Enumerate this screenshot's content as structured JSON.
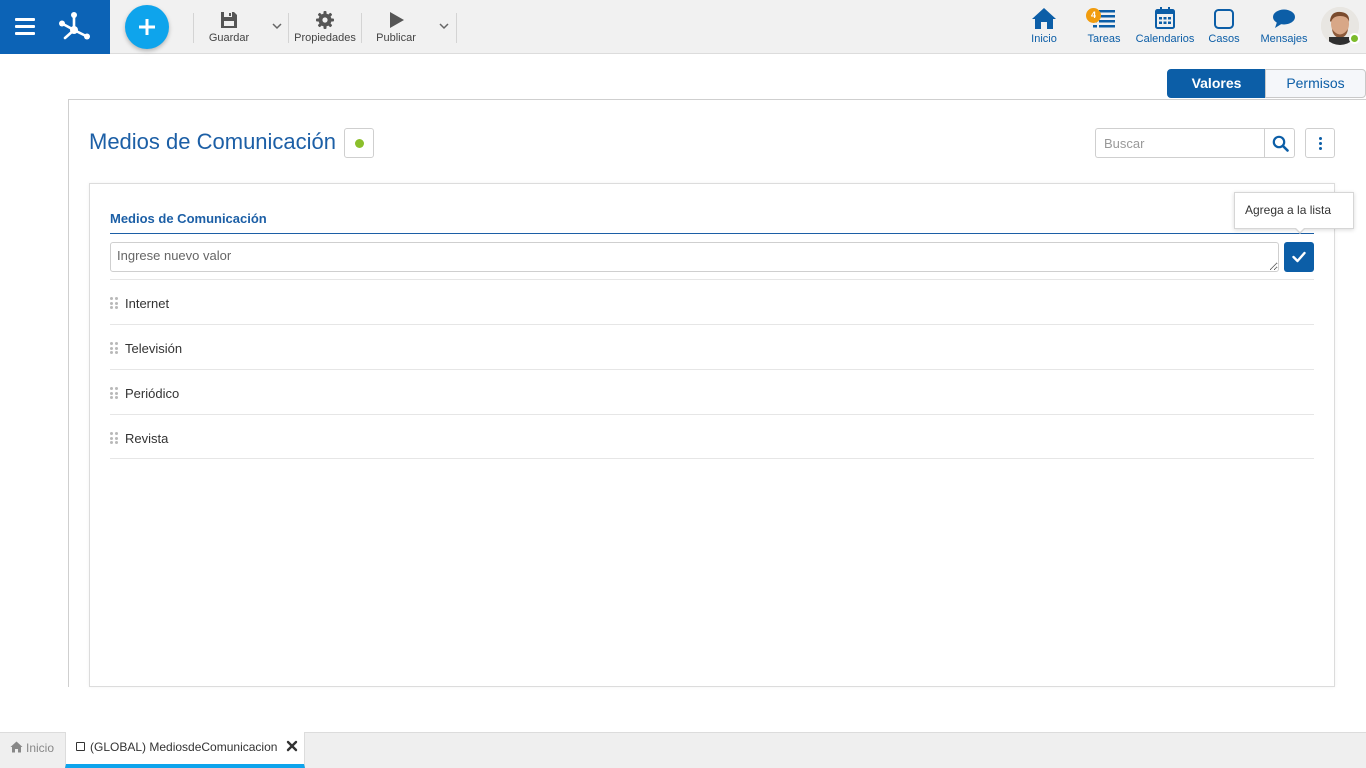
{
  "toolbar": {
    "save_label": "Guardar",
    "properties_label": "Propiedades",
    "publish_label": "Publicar"
  },
  "nav": {
    "items": [
      {
        "label": "Inicio",
        "icon": "home-icon"
      },
      {
        "label": "Tareas",
        "icon": "tasks-icon",
        "badge": "4"
      },
      {
        "label": "Calendarios",
        "icon": "calendar-icon"
      },
      {
        "label": "Casos",
        "icon": "cases-icon"
      },
      {
        "label": "Mensajes",
        "icon": "messages-icon"
      }
    ]
  },
  "tabs": {
    "values": "Valores",
    "permissions": "Permisos"
  },
  "page": {
    "title": "Medios de Comunicación",
    "search_placeholder": "Buscar"
  },
  "card": {
    "title": "Medios de Comunicación",
    "new_value_placeholder": "Ingrese nuevo valor",
    "tooltip": "Agrega a la lista",
    "items": [
      "Internet",
      "Televisión",
      "Periódico",
      "Revista"
    ]
  },
  "bottom_tabs": {
    "home": "Inicio",
    "active": "(GLOBAL) MediosdeComunicacion"
  },
  "colors": {
    "primary": "#0c5ea7",
    "brand": "#0c63b6",
    "accent": "#0ea4ec",
    "status_green": "#8bbf2b",
    "badge_orange": "#f19c0e"
  }
}
